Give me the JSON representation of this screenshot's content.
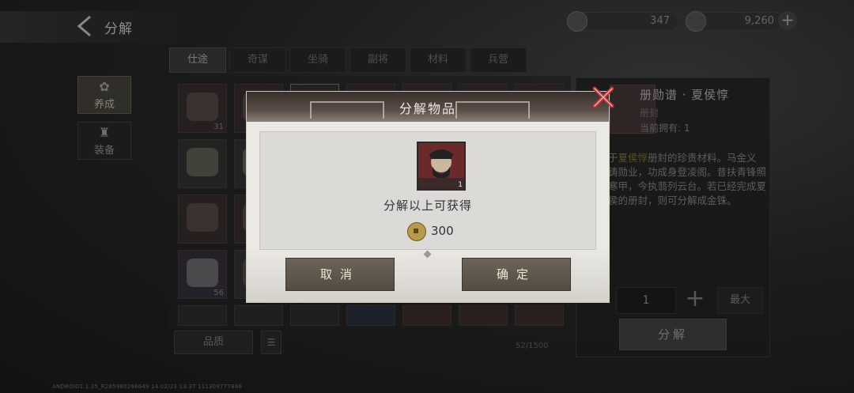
{
  "header": {
    "title": "分解",
    "currency1": "347",
    "currency2": "9,260",
    "plus": "+"
  },
  "side_nav": [
    {
      "label": "养成",
      "icon": "✿",
      "active": true
    },
    {
      "label": "装备",
      "icon": "♜",
      "active": false
    }
  ],
  "tabs": [
    "仕途",
    "奇谋",
    "坐骑",
    "副将",
    "材料",
    "兵营"
  ],
  "grid": {
    "counts": [
      "31",
      "",
      "",
      "",
      "",
      "",
      "",
      "",
      "",
      "",
      "",
      "",
      "56",
      "",
      "",
      "",
      "",
      "",
      "",
      "",
      "",
      "",
      "",
      ""
    ]
  },
  "bottom_bar": {
    "quality_label": "品质",
    "sort_icon": "☰",
    "capacity": "52/1500"
  },
  "detail": {
    "name": "册勋谱 · 夏侯惇",
    "type": "册封",
    "owned": "当前拥有: 1",
    "desc_prefix": "于",
    "desc_highlight": "夏侯惇",
    "desc_rest": "册封的珍贵材料。马金义铸勋业，功成身登凌阁。昔扶青锋照寒甲，今执翡列云台。若已经完成夏侯的册封，则可分解成金铢。",
    "quantity": "1",
    "plus": "+",
    "max_label": "最大",
    "decompose_label": "分解"
  },
  "dialog": {
    "title": "分解物品",
    "item_count": "1",
    "message": "分解以上可获得",
    "reward_value": "300",
    "cancel_label": "取消",
    "confirm_label": "确定"
  },
  "build_info": "ANDROID1.1.35_R285980266649 14 02/23 13:37 111309777846",
  "colors": {
    "dialog_bg": "#ebe9e4",
    "button_bg": "#5e564c",
    "highlight": "#8a7a3a"
  }
}
